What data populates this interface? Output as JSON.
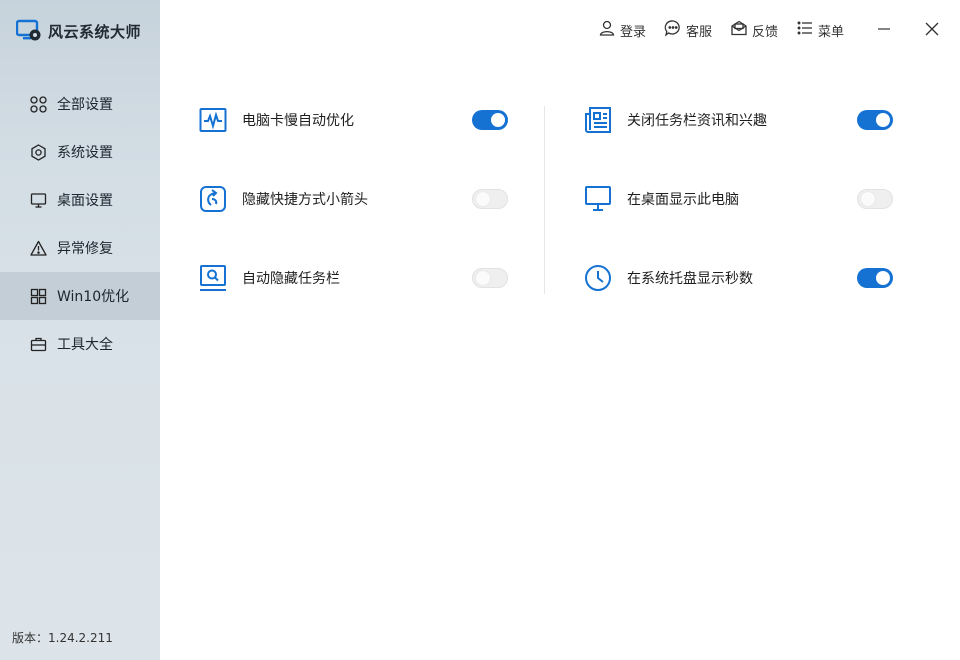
{
  "app": {
    "title": "风云系统大师",
    "version_label": "版本：",
    "version": "1.24.2.211",
    "accent": "#1572d3"
  },
  "topbar": {
    "login": "登录",
    "support": "客服",
    "feedback": "反馈",
    "menu": "菜单"
  },
  "sidebar": {
    "items": [
      {
        "label": "全部设置",
        "icon": "grid-icon",
        "active": false
      },
      {
        "label": "系统设置",
        "icon": "settings-icon",
        "active": false
      },
      {
        "label": "桌面设置",
        "icon": "monitor-icon",
        "active": false
      },
      {
        "label": "异常修复",
        "icon": "warning-icon",
        "active": false
      },
      {
        "label": "Win10优化",
        "icon": "windows-icon",
        "active": true
      },
      {
        "label": "工具大全",
        "icon": "toolbox-icon",
        "active": false
      }
    ]
  },
  "options": {
    "left": [
      {
        "label": "电脑卡慢自动优化",
        "icon": "performance-monitor-icon",
        "enabled": true
      },
      {
        "label": "隐藏快捷方式小箭头",
        "icon": "shortcut-arrow-icon",
        "enabled": false
      },
      {
        "label": "自动隐藏任务栏",
        "icon": "taskbar-search-icon",
        "enabled": false
      }
    ],
    "right": [
      {
        "label": "关闭任务栏资讯和兴趣",
        "icon": "news-icon",
        "enabled": true
      },
      {
        "label": "在桌面显示此电脑",
        "icon": "desktop-pc-icon",
        "enabled": false
      },
      {
        "label": "在系统托盘显示秒数",
        "icon": "clock-icon",
        "enabled": true
      }
    ]
  }
}
